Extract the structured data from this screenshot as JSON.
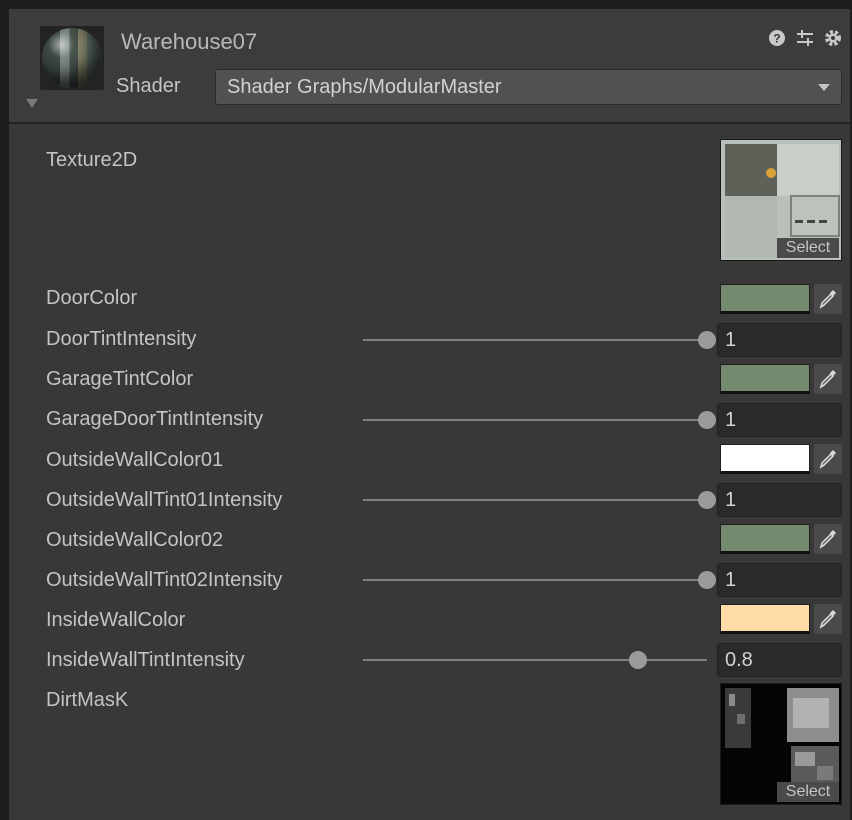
{
  "material": {
    "name": "Warehouse07",
    "shader_label": "Shader",
    "shader_value": "Shader Graphs/ModularMaster"
  },
  "header_icons": [
    "help-icon",
    "preset-icon",
    "settings-icon"
  ],
  "properties": {
    "texture2d": {
      "label": "Texture2D",
      "select_label": "Select"
    },
    "door_color": {
      "label": "DoorColor",
      "color": "#738a6f"
    },
    "door_tint_intensity": {
      "label": "DoorTintIntensity",
      "value": "1",
      "slider": 1.0
    },
    "garage_tint_color": {
      "label": "GarageTintColor",
      "color": "#738a6f"
    },
    "garage_door_tint_intensity": {
      "label": "GarageDoorTintIntensity",
      "value": "1",
      "slider": 1.0
    },
    "outside_wall_color01": {
      "label": "OutsideWallColor01",
      "color": "#ffffff"
    },
    "outside_wall_tint01_intensity": {
      "label": "OutsideWallTint01Intensity",
      "value": "1",
      "slider": 1.0
    },
    "outside_wall_color02": {
      "label": "OutsideWallColor02",
      "color": "#738a6f"
    },
    "outside_wall_tint02_intensity": {
      "label": "OutsideWallTint02Intensity",
      "value": "1",
      "slider": 1.0
    },
    "inside_wall_color": {
      "label": "InsideWallColor",
      "color": "#ffdba8"
    },
    "inside_wall_tint_intensity": {
      "label": "InsideWallTintIntensity",
      "value": "0.8",
      "slider": 0.8
    },
    "dirt_mask": {
      "label": "DirtMasK",
      "select_label": "Select"
    }
  },
  "colors": {
    "panel_bg": "#383838",
    "header_bg": "#3c3c3c",
    "field_bg": "#2a2a2a",
    "text": "#c4c4c4"
  }
}
